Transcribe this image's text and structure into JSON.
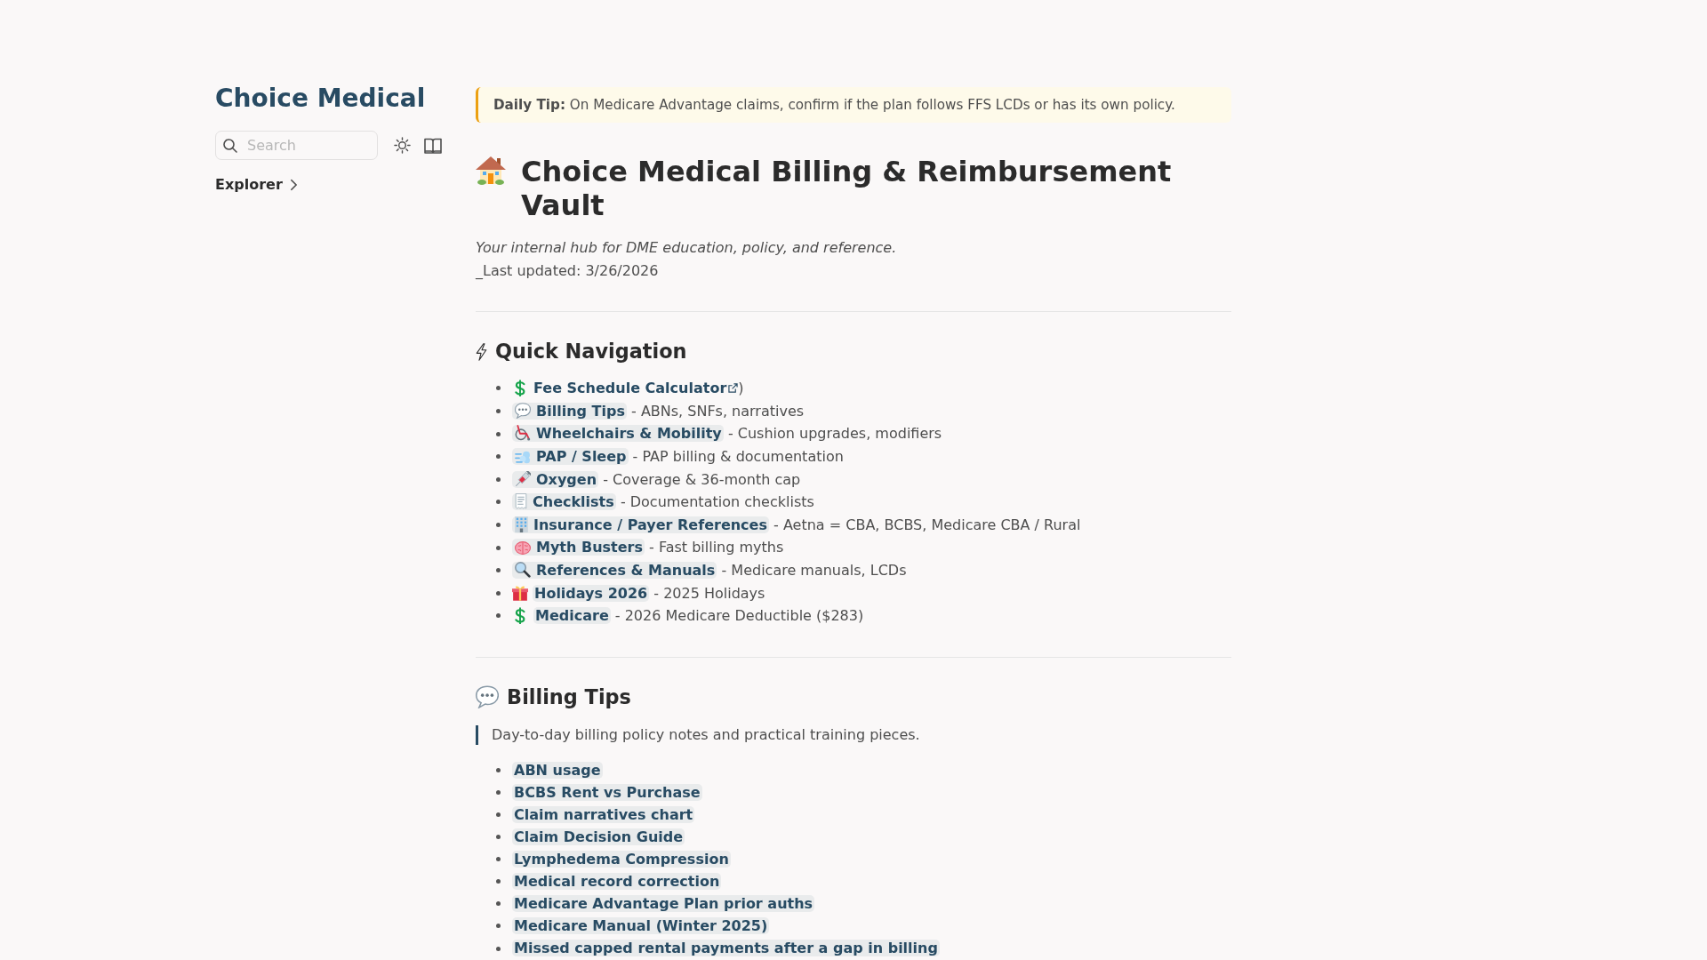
{
  "sidebar": {
    "title": "Choice Medical",
    "search": {
      "placeholder": "Search"
    },
    "explorer": {
      "label": "Explorer",
      "expanded": false
    }
  },
  "daily_tip": {
    "text": "**Daily Tip:** On Medicare Advantage claims, confirm if the plan follows FFS LCDs or has its own policy."
  },
  "page": {
    "title": "Choice Medical Billing & Reimbursement Vault",
    "subtitle": "Your internal hub for DME education, policy, and reference.",
    "last_updated": "_Last updated: 3/26/2026"
  },
  "sections": [
    {
      "kind": "nav",
      "heading": "Quick Navigation",
      "items": [
        {
          "kind": "external",
          "label": "Fee Schedule Calculator",
          "suffix": ")"
        },
        {
          "kind": "inline",
          "label": "Billing Tips",
          "description": "- ABNs, SNFs, narratives"
        },
        {
          "kind": "inline",
          "label": "Wheelchairs & Mobility",
          "description": "- Cushion upgrades, modifiers"
        },
        {
          "kind": "inline",
          "label": "PAP / Sleep",
          "description": "- PAP billing & documentation"
        },
        {
          "kind": "inline",
          "label": "Oxygen",
          "description": "- Coverage & 36-month cap"
        },
        {
          "kind": "inline",
          "label": "Checklists",
          "description": "- Documentation checklists"
        },
        {
          "kind": "inline",
          "label": "Insurance / Payer References",
          "description": "- Aetna = CBA, BCBS, Medicare CBA / Rural"
        },
        {
          "kind": "inline",
          "label": "Myth Busters",
          "description": "- Fast billing myths"
        },
        {
          "kind": "inline",
          "label": "References & Manuals",
          "description": "- Medicare manuals, LCDs"
        },
        {
          "kind": "prefixed",
          "label": "Holidays 2026",
          "description": "- 2025 Holidays"
        },
        {
          "kind": "prefixed",
          "label": "Medicare",
          "description": "- 2026 Medicare Deductible ($283)"
        }
      ]
    },
    {
      "kind": "links",
      "heading": "Billing Tips",
      "quote": "Day-to-day billing policy notes and practical training pieces.",
      "items": [
        "ABN usage",
        "BCBS Rent vs Purchase",
        "Claim narratives chart",
        "Claim Decision Guide",
        "Lymphedema Compression",
        "Medical record correction",
        "Medicare Advantage Plan prior auths",
        "Medicare Manual (Winter 2025)",
        "Missed capped rental payments after a gap in billing"
      ]
    }
  ]
}
